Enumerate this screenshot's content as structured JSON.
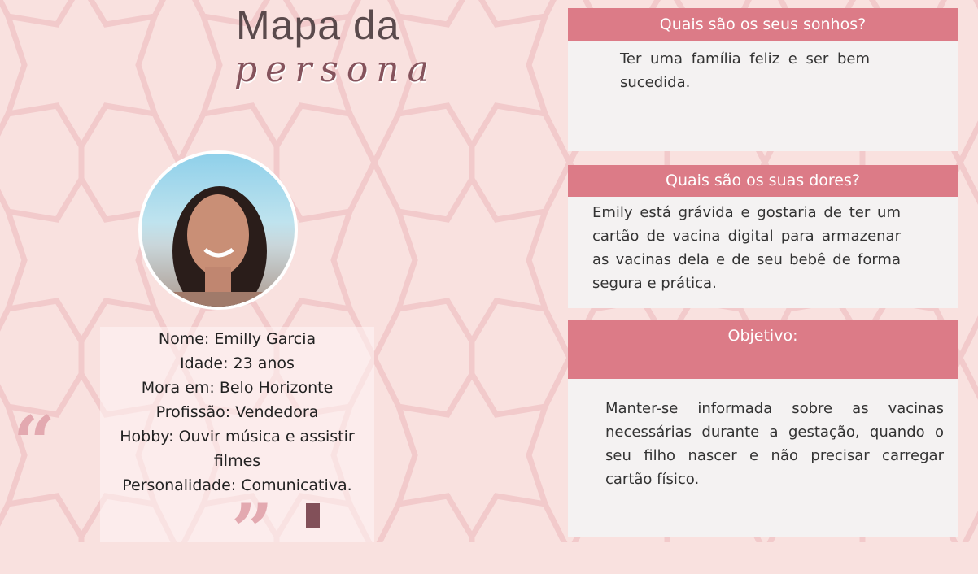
{
  "title": {
    "line1": "Mapa da",
    "line2": "persona"
  },
  "persona": {
    "photo_icon": "portrait-photo",
    "fields": [
      "Nome: Emilly Garcia",
      "Idade: 23 anos",
      "Mora em: Belo Horizonte",
      "Profissão: Vendedora",
      "Hobby: Ouvir música e assistir filmes",
      "Personalidade: Comunicativa."
    ],
    "quote_open": "“",
    "quote_close": "”"
  },
  "panels": [
    {
      "header": "Quais são os seus sonhos?",
      "body": "Ter uma família feliz e ser bem sucedida."
    },
    {
      "header": "Quais são os suas dores?",
      "body": "Emily está grávida e gostaria de ter um cartão de vacina digital para armazenar as vacinas dela e de seu bebê de forma segura e prática."
    },
    {
      "header": "Objetivo:",
      "body": "Manter-se informada sobre as vacinas necessárias durante a gestação, quando o seu filho nascer e não precisar carregar cartão físico."
    }
  ],
  "colors": {
    "background": "#f9e1df",
    "pattern": "#f0c4c6",
    "header": "#dc7b87",
    "accent": "#825059",
    "quote": "#e3a9b0"
  }
}
